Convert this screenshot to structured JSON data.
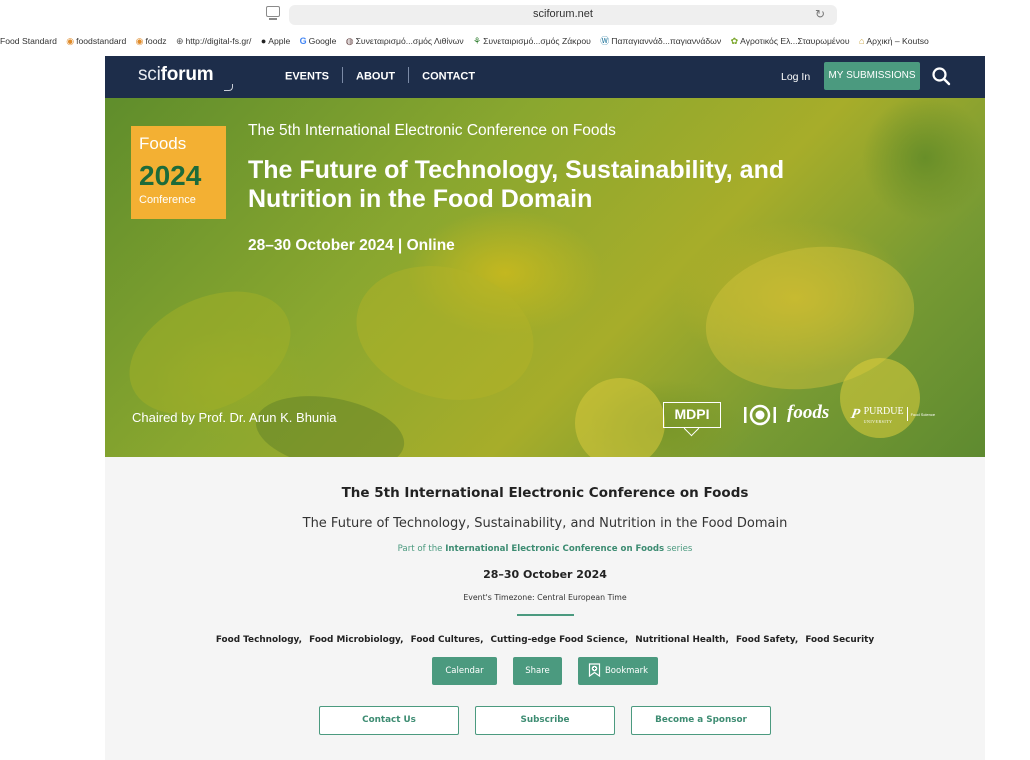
{
  "browser": {
    "url": "sciforum.net",
    "bookmarks": [
      {
        "label": "Food Standard",
        "icon": ""
      },
      {
        "label": "foodstandard",
        "icon": "circle-logo-icon"
      },
      {
        "label": "foodz",
        "icon": "circle-logo-icon"
      },
      {
        "label": "http://digital-fs.gr/",
        "icon": "globe-icon"
      },
      {
        "label": "Apple",
        "icon": "apple-icon"
      },
      {
        "label": "Google",
        "icon": "google-icon"
      },
      {
        "label": "Συνεταιρισμό...σμός Λιθίνων",
        "icon": "site-icon"
      },
      {
        "label": "Συνεταιρισμό...σμός Ζάκρου",
        "icon": "coop-icon"
      },
      {
        "label": "Παπαγιαννάδ...παγιαννάδων",
        "icon": "wordpress-icon"
      },
      {
        "label": "Αγροτικός Ελ...Σταυρωμένου",
        "icon": "leaf-icon"
      },
      {
        "label": "Αρχική – Koutso",
        "icon": "home-icon"
      }
    ]
  },
  "nav": {
    "logo_sci": "sci",
    "logo_forum": "forum",
    "links": [
      "EVENTS",
      "ABOUT",
      "CONTACT"
    ],
    "login": "Log In",
    "submissions": "MY SUBMISSIONS"
  },
  "hero": {
    "badge_name": "Foods",
    "badge_year": "2024",
    "badge_sub": "Conference",
    "overline": "The 5th International Electronic Conference on Foods",
    "title": "The Future of Technology, Sustainability, and Nutrition in the Food Domain",
    "date_line": "28–30 October 2024 | Online",
    "chair": "Chaired by Prof. Dr. Arun K. Bhunia",
    "logo_mdpi": "MDPI",
    "logo_foods": "foods",
    "logo_purdue": "PURDUE",
    "logo_purdue_sub": "UNIVERSITY",
    "logo_purdue_dept": "Food Science"
  },
  "info": {
    "title": "The 5th International Electronic Conference on Foods",
    "subtitle": "The Future of Technology, Sustainability, and Nutrition in the Food Domain",
    "series_prefix": "Part of the ",
    "series_link": "International Electronic Conference on Foods",
    "series_suffix": " series",
    "date": "28–30 October 2024",
    "timezone": "Event's Timezone: Central European Time",
    "topics": [
      "Food Technology,",
      "Food Microbiology,",
      "Food Cultures,",
      "Cutting-edge Food Science,",
      "Nutritional Health,",
      "Food Safety,",
      "Food Security"
    ],
    "actions": {
      "calendar": "Calendar",
      "share": "Share",
      "bookmark": "Bookmark"
    },
    "ctas": {
      "contact": "Contact Us",
      "subscribe": "Subscribe",
      "sponsor": "Become a Sponsor"
    }
  },
  "colors": {
    "nav_bg": "#1d2d4a",
    "accent": "#4b9a7f",
    "badge": "#f3b033",
    "badge_year": "#1d6b3a"
  }
}
